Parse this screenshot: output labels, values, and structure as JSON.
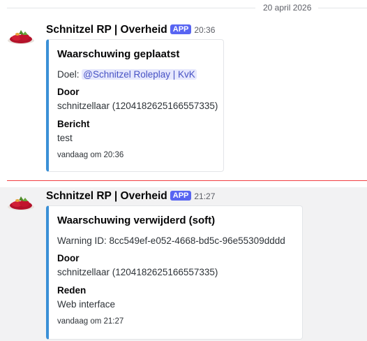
{
  "date_divider": "20 april 2026",
  "messages": [
    {
      "author": "Schnitzel RP | Overheid",
      "badge": "APP",
      "time": "20:36",
      "embed": {
        "title": "Waarschuwing geplaatst",
        "desc_prefix": "Doel: ",
        "mention": "@Schnitzel Roleplay | KvK",
        "fields": [
          {
            "name": "Door",
            "value": "schnitzellaar (1204182625166557335)"
          },
          {
            "name": "Bericht",
            "value": "test"
          }
        ],
        "footer": "vandaag om 20:36"
      }
    },
    {
      "author": "Schnitzel RP | Overheid",
      "badge": "APP",
      "time": "21:27",
      "embed": {
        "title": "Waarschuwing verwijderd (soft)",
        "description": "Warning ID: 8cc549ef-e052-4668-bd5c-96e55309dddd",
        "fields": [
          {
            "name": "Door",
            "value": "schnitzellaar (1204182625166557335)"
          },
          {
            "name": "Reden",
            "value": "Web interface"
          }
        ],
        "footer": "vandaag om 21:27"
      }
    }
  ],
  "colors": {
    "embed_border": "#3b90d6",
    "app_badge": "#5865f2",
    "new_message_line": "#f23f42"
  }
}
